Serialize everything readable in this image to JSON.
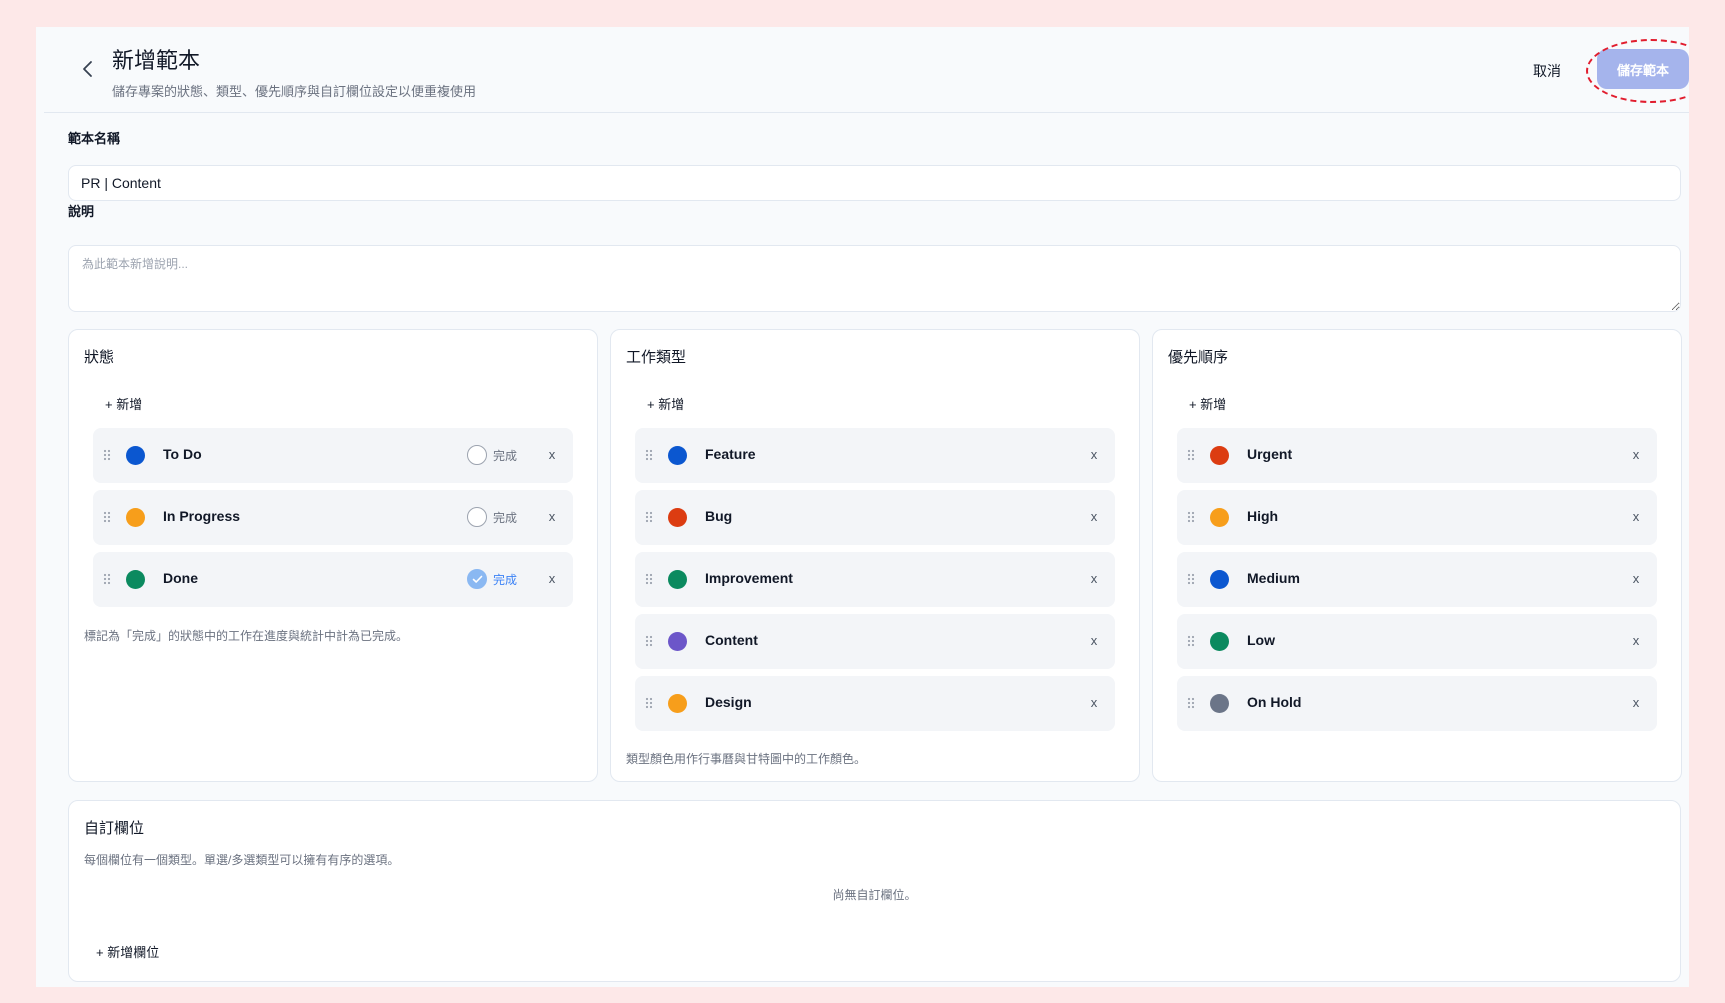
{
  "header": {
    "title": "新增範本",
    "subtitle": "儲存專案的狀態、類型、優先順序與自訂欄位設定以便重複使用",
    "cancel_label": "取消",
    "save_label": "儲存範本"
  },
  "form": {
    "name_label": "範本名稱",
    "name_value": "PR | Content",
    "desc_label": "說明",
    "desc_placeholder": "為此範本新增說明..."
  },
  "status_panel": {
    "title": "狀態",
    "add_label": "+ 新增",
    "items": [
      {
        "label": "To Do",
        "color": "#0b57d0",
        "done": false,
        "done_label": "完成"
      },
      {
        "label": "In Progress",
        "color": "#f79e1b",
        "done": false,
        "done_label": "完成"
      },
      {
        "label": "Done",
        "color": "#0b8a5f",
        "done": true,
        "done_label": "完成"
      }
    ],
    "note": "標記為「完成」的狀態中的工作在進度與統計中計為已完成。"
  },
  "type_panel": {
    "title": "工作類型",
    "add_label": "+ 新增",
    "items": [
      {
        "label": "Feature",
        "color": "#0b57d0"
      },
      {
        "label": "Bug",
        "color": "#dc3c11"
      },
      {
        "label": "Improvement",
        "color": "#0b8a5f"
      },
      {
        "label": "Content",
        "color": "#6c56c9"
      },
      {
        "label": "Design",
        "color": "#f79e1b"
      }
    ],
    "note": "類型顏色用作行事曆與甘特圖中的工作顏色。"
  },
  "priority_panel": {
    "title": "優先順序",
    "add_label": "+ 新增",
    "items": [
      {
        "label": "Urgent",
        "color": "#dc3c11"
      },
      {
        "label": "High",
        "color": "#f79e1b"
      },
      {
        "label": "Medium",
        "color": "#0b57d0"
      },
      {
        "label": "Low",
        "color": "#0b8a5f"
      },
      {
        "label": "On Hold",
        "color": "#6b7588"
      }
    ]
  },
  "custom_fields": {
    "title": "自訂欄位",
    "description": "每個欄位有一個類型。單選/多選類型可以擁有有序的選項。",
    "empty_text": "尚無自訂欄位。",
    "add_label": "+ 新增欄位"
  },
  "icons": {
    "back": "chevron-left-icon",
    "drag": "drag-handle-icon",
    "remove_glyph": "x",
    "check": "check-icon"
  }
}
